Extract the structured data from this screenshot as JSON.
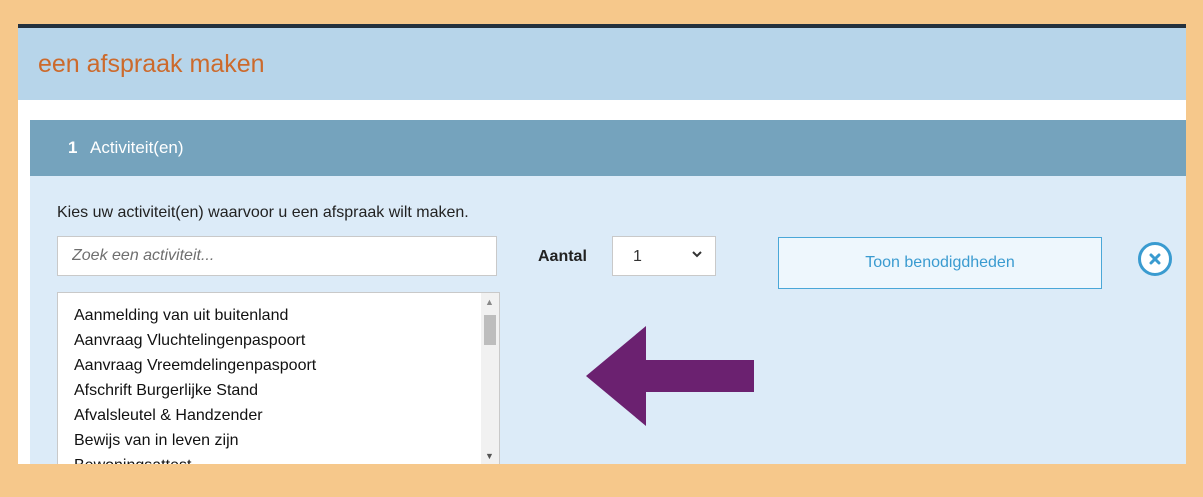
{
  "header": {
    "title": "een afspraak maken"
  },
  "section": {
    "number": "1",
    "label": "Activiteit(en)"
  },
  "content": {
    "instruction": "Kies uw activiteit(en) waarvoor u een afspraak wilt maken.",
    "search": {
      "placeholder": "Zoek een activiteit...",
      "value": ""
    },
    "aantal": {
      "label": "Aantal",
      "selected": "1"
    },
    "toon_button": "Toon benodigdheden",
    "close_icon": "close-circle-icon",
    "activities": [
      "Aanmelding van uit buitenland",
      "Aanvraag Vluchtelingenpaspoort",
      "Aanvraag Vreemdelingenpaspoort",
      "Afschrift Burgerlijke Stand",
      "Afvalsleutel & Handzender",
      "Bewijs van in leven zijn",
      "Bewoningsattest"
    ]
  },
  "annotation": {
    "arrow_icon": "left-arrow-icon",
    "arrow_color": "#6b2170"
  },
  "colors": {
    "page_background": "#f6c88b",
    "header_background": "#b7d5ea",
    "title_color": "#cc6a2c",
    "section_bar": "#75a3bd",
    "content_background": "#dcebf8",
    "accent_blue": "#3a9bd0"
  }
}
